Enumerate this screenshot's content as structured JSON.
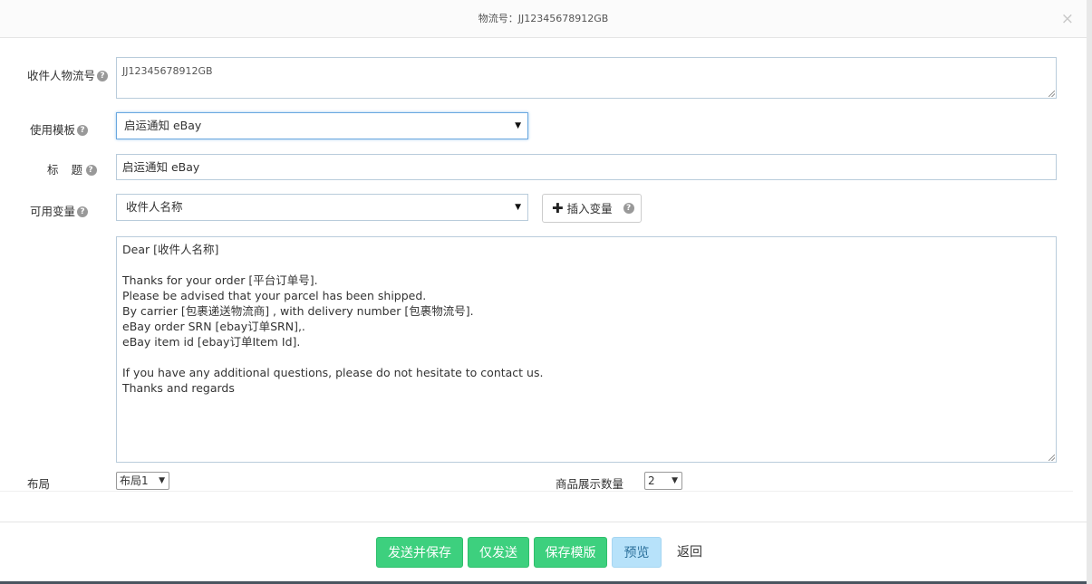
{
  "header": {
    "title": "物流号：JJ12345678912GB",
    "close_glyph": "×"
  },
  "help_glyph": "?",
  "form": {
    "tracking_label": "收件人物流号",
    "tracking_value": "JJ12345678912GB",
    "template_label": "使用模板",
    "template_value": "启运通知 eBay",
    "subject_label": "标  题",
    "subject_value": "启运通知 eBay",
    "variables_label": "可用变量",
    "variables_value": "收件人名称",
    "insert_button": "插入变量",
    "body_text": "Dear [收件人名称]\n\nThanks for your order [平台订单号].\nPlease be advised that your parcel has been shipped.\nBy carrier [包裹递送物流商] , with delivery number [包裹物流号].\neBay order SRN [ebay订单SRN],.\neBay item id [ebay订单Item Id].\n\nIf you have any additional questions, please do not hesitate to contact us.\nThanks and regards",
    "layout_label": "布局",
    "layout_value": "布局1",
    "product_count_label": "商品展示数量",
    "product_count_value": "2"
  },
  "footer": {
    "send_save": "发送并保存",
    "send_only": "仅发送",
    "save_template": "保存模版",
    "preview": "预览",
    "back": "返回"
  },
  "colors": {
    "green": "#3dd07e",
    "light_blue": "#b7e2fa"
  }
}
